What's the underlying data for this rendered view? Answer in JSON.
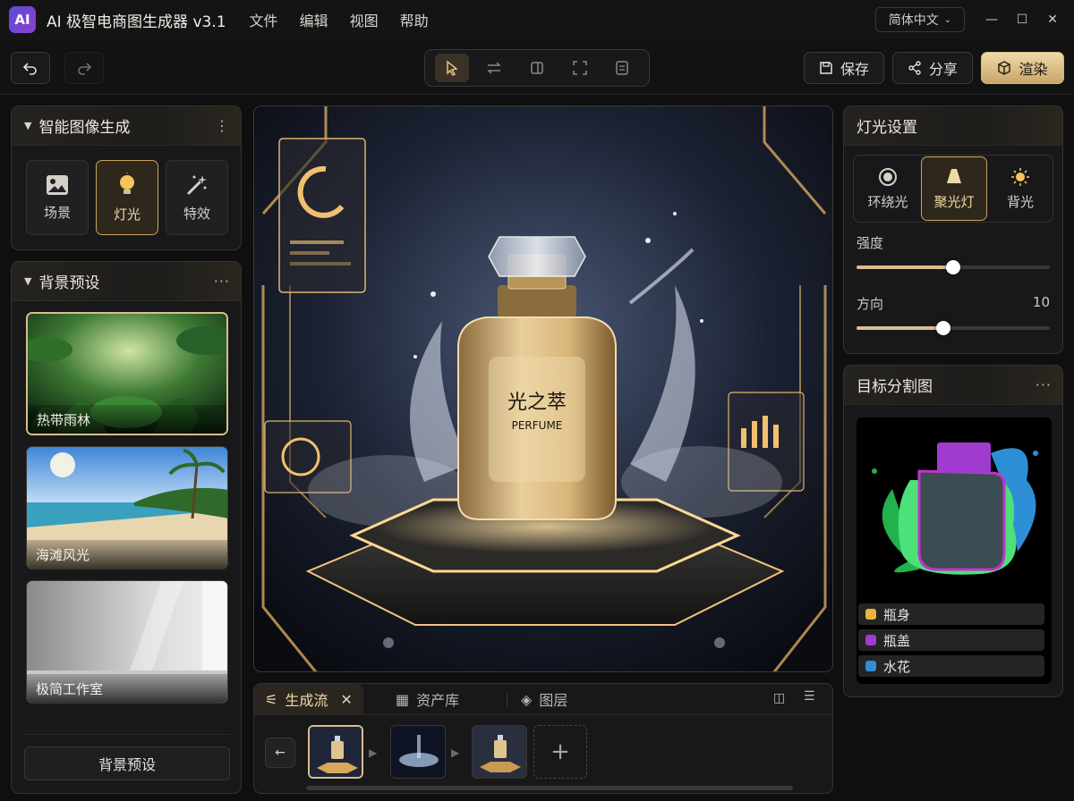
{
  "app": {
    "logo": "AI",
    "title": "AI 极智电商图生成器 v3.1"
  },
  "menu": [
    "文件",
    "编辑",
    "视图",
    "帮助"
  ],
  "language": {
    "selected": "简体中文"
  },
  "toolbar": {
    "save": "保存",
    "share": "分享",
    "render": "渲染"
  },
  "smart_gen": {
    "title": "智能图像生成",
    "buttons": [
      {
        "label": "场景",
        "icon": "image-icon"
      },
      {
        "label": "灯光",
        "icon": "bulb-icon",
        "active": true
      },
      {
        "label": "特效",
        "icon": "magic-wand-icon"
      }
    ]
  },
  "bg_presets": {
    "title": "背景预设",
    "items": [
      {
        "label": "热带雨林",
        "active": true
      },
      {
        "label": "海滩风光"
      },
      {
        "label": "极简工作室"
      }
    ],
    "button": "背景预设"
  },
  "canvas": {
    "bottle_label": "光之萃",
    "bottle_sub": "PERFUME"
  },
  "lighting": {
    "title": "灯光设置",
    "modes": [
      {
        "label": "环绕光",
        "icon": "ring-light-icon"
      },
      {
        "label": "聚光灯",
        "icon": "spotlight-icon",
        "active": true
      },
      {
        "label": "背光",
        "icon": "sun-icon"
      }
    ],
    "intensity": {
      "label": "强度",
      "fraction": 0.5
    },
    "direction": {
      "label": "方向",
      "value": "10",
      "fraction": 0.45
    }
  },
  "segmentation": {
    "title": "目标分割图",
    "legend": [
      {
        "label": "瓶身",
        "color": "#e8b73a"
      },
      {
        "label": "瓶盖",
        "color": "#a13bd0"
      },
      {
        "label": "水花",
        "color": "#2f8fd6"
      }
    ]
  },
  "bottom": {
    "tabs": [
      {
        "label": "生成流",
        "active": true
      },
      {
        "label": "资产库"
      },
      {
        "label": "图层"
      }
    ]
  }
}
